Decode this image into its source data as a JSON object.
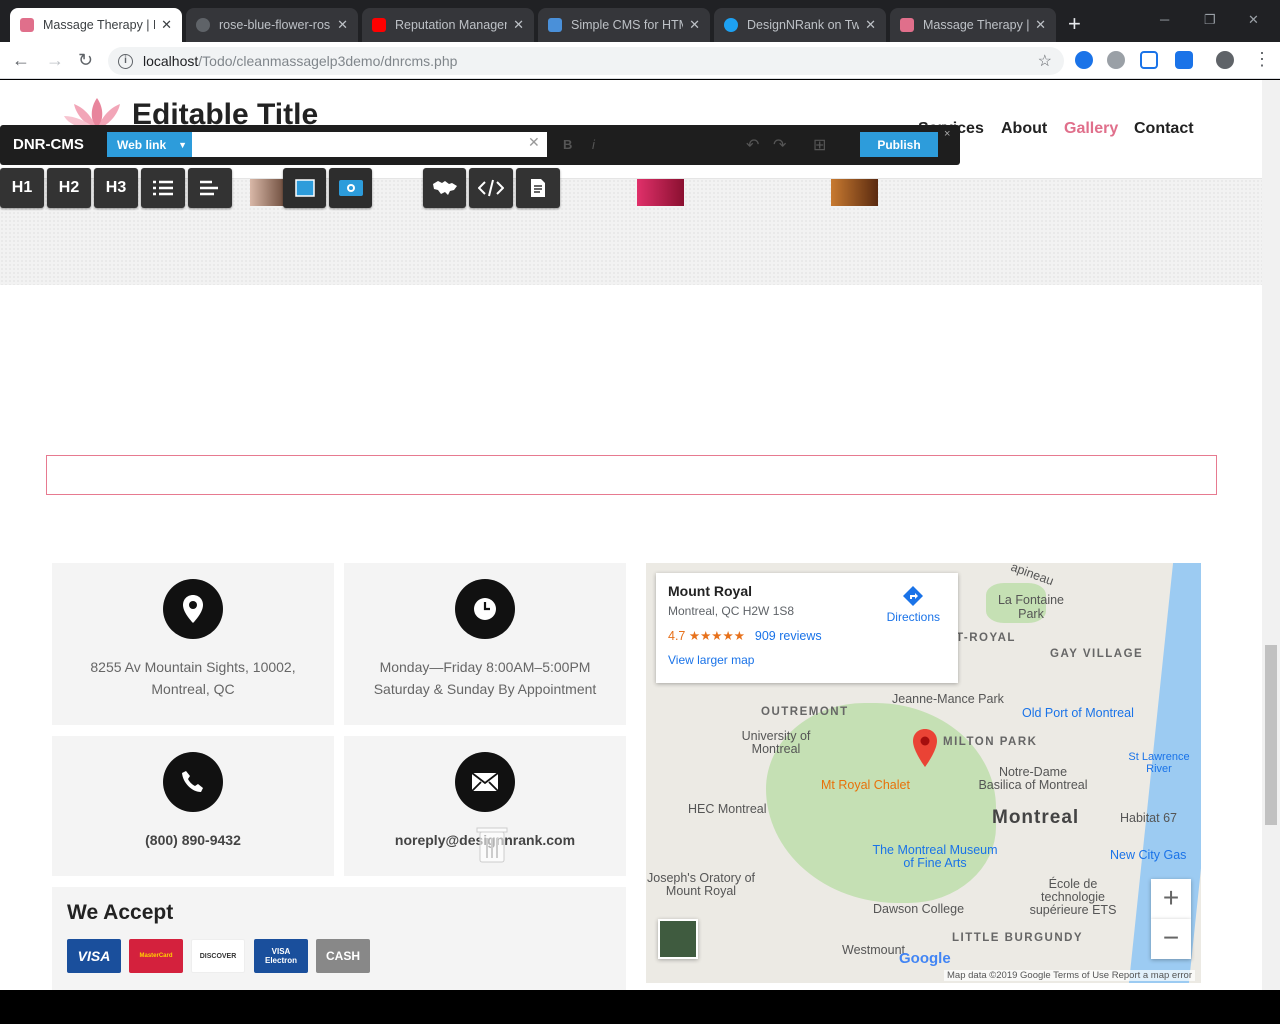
{
  "browser": {
    "tabs": [
      {
        "title": "Massage Therapy | F",
        "color": "#e06f8b",
        "active": true
      },
      {
        "title": "rose-blue-flower-ros",
        "color": "#9aa0a6",
        "active": false
      },
      {
        "title": "Reputation Manager",
        "color": "#ff0000",
        "active": false
      },
      {
        "title": "Simple CMS for HTM",
        "color": "#4a90d9",
        "active": false
      },
      {
        "title": "DesignNRank on Twi",
        "color": "#1da1f2",
        "active": false
      },
      {
        "title": "Massage Therapy | F",
        "color": "#e06f8b",
        "active": false
      }
    ],
    "new_tab_label": "+",
    "url_host": "localhost",
    "url_path": "/Todo/cleanmassagelp3demo/dnrcms.php"
  },
  "site": {
    "title": "Editable Title",
    "nav": [
      {
        "label": "Services",
        "active": false
      },
      {
        "label": "About",
        "active": false
      },
      {
        "label": "Gallery",
        "active": true
      },
      {
        "label": "Contact",
        "active": false
      }
    ],
    "accent": "#e06f8b"
  },
  "cms": {
    "brand": "DNR-CMS",
    "link_type": "Web link",
    "link_value": "",
    "bold_label": "B",
    "italic_label": "i",
    "publish_label": "Publish",
    "close_label": "×",
    "buttons": [
      "H1",
      "H2",
      "H3"
    ],
    "accent": "#2d9cdb"
  },
  "contact": {
    "address_line1": "8255 Av Mountain Sights, 10002,",
    "address_line2": "Montreal, QC",
    "hours_line1": "Monday—Friday 8:00AM–5:00PM",
    "hours_line2": "Saturday & Sunday By Appointment",
    "phone": "(800) 890-9432",
    "email": "noreply@designnrank.com",
    "accept_title": "We Accept",
    "payments": [
      "VISA",
      "MasterCard",
      "DISCOVER",
      "VISA Electron",
      "CASH"
    ]
  },
  "map": {
    "place": "Mount Royal",
    "address": "Montreal, QC H2W 1S8",
    "rating": "4.7",
    "stars": "★★★★★",
    "reviews": "909 reviews",
    "larger_map": "View larger map",
    "directions": "Directions",
    "labels": {
      "montreal": "Montreal",
      "outremont": "OUTREMONT",
      "milton_park": "MILTON PARK",
      "gay_village": "GAY VILLAGE",
      "little_burgundy": "LITTLE BURGUNDY",
      "jeanne_mance": "Jeanne-Mance Park",
      "old_port": "Old Port of Montreal",
      "chalet": "Mt Royal Chalet",
      "udem": "University of Montreal",
      "hec": "HEC Montreal",
      "basilica": "Notre-Dame Basilica of Montreal",
      "habitat": "Habitat 67",
      "museum": "The Montreal Museum of Fine Arts",
      "new_city_gas": "New City Gas",
      "st_joseph": "Joseph's Oratory of Mount Royal",
      "dawson": "Dawson College",
      "ets": "École de technologie supérieure ETS",
      "la_fontaine": "La Fontaine Park",
      "westmount": "Westmount",
      "st_lawrence": "St Lawrence River",
      "royal": "T-ROYAL",
      "papineau": "apineau"
    },
    "attribution": "Map data ©2019 Google   Terms of Use   Report a map error",
    "zoom_in": "+",
    "zoom_out": "−"
  }
}
